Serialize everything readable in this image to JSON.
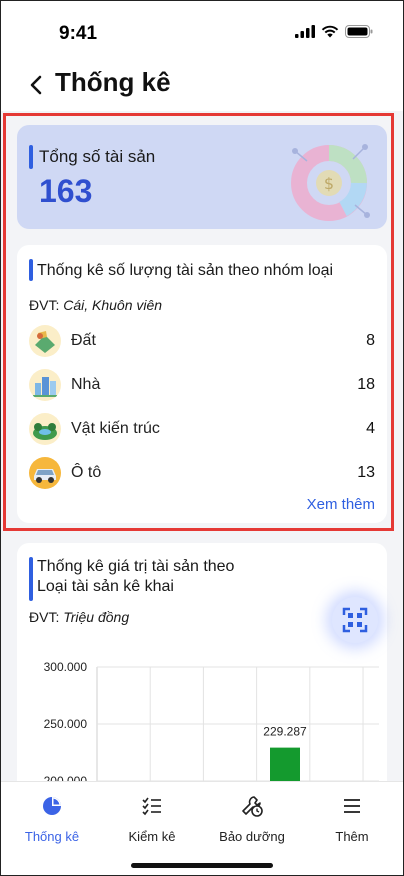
{
  "status": {
    "time": "9:41"
  },
  "header": {
    "title": "Thống kê"
  },
  "total": {
    "label": "Tổng số tài sản",
    "value": "163"
  },
  "group_stats": {
    "title": "Thống kê số lượng tài sản theo nhóm loại",
    "unit_prefix": "ĐVT: ",
    "unit": "Cái, Khuôn viên",
    "items": [
      {
        "label": "Đất",
        "count": "8",
        "icon": "land-icon"
      },
      {
        "label": "Nhà",
        "count": "18",
        "icon": "building-icon"
      },
      {
        "label": "Vật kiến trúc",
        "count": "4",
        "icon": "architecture-icon"
      },
      {
        "label": "Ô tô",
        "count": "13",
        "icon": "car-icon"
      }
    ],
    "see_more": "Xem thêm"
  },
  "value_stats": {
    "title_line1": "Thống kê giá trị tài sản theo",
    "title_line2": "Loại tài sản kê khai",
    "unit_prefix": "ĐVT: ",
    "unit": "Triệu đồng"
  },
  "chart_data": {
    "type": "bar",
    "y_ticks": [
      "300.000",
      "250.000",
      "200.000"
    ],
    "values": [
      229.287
    ],
    "data_labels": [
      "229.287"
    ],
    "bar_color": "#149a2e",
    "grid": true
  },
  "tabs": [
    {
      "label": "Thống kê",
      "icon": "pie-chart-icon",
      "active": true
    },
    {
      "label": "Kiểm kê",
      "icon": "checklist-icon",
      "active": false
    },
    {
      "label": "Bảo dưỡng",
      "icon": "maintenance-icon",
      "active": false
    },
    {
      "label": "Thêm",
      "icon": "menu-icon",
      "active": false
    }
  ],
  "colors": {
    "accent": "#2f5fe0",
    "highlight_border": "#e53935",
    "active_tab": "#3b63e6"
  }
}
